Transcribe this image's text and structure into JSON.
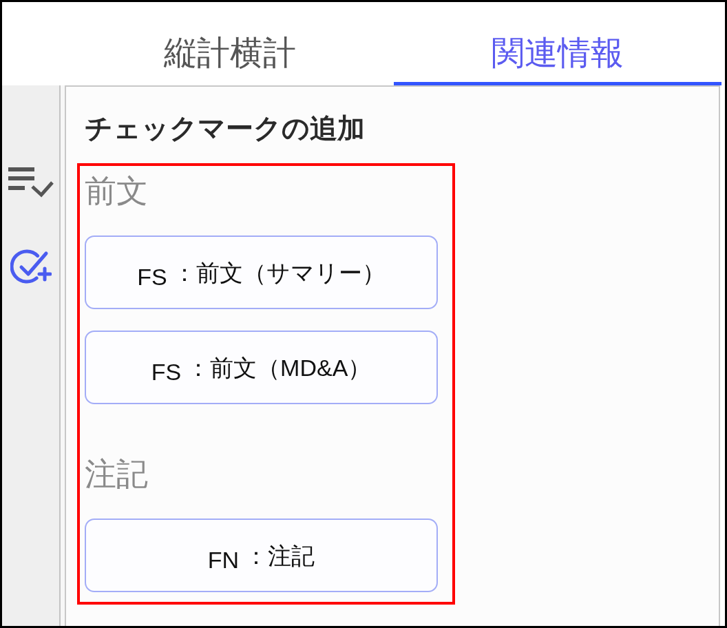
{
  "tabs": [
    {
      "label": "縦計横計",
      "selected": false
    },
    {
      "label": "関連情報",
      "selected": true
    }
  ],
  "sidebar": {
    "items": [
      {
        "kind": "list-check",
        "selected": false
      },
      {
        "kind": "check-add",
        "selected": true
      }
    ]
  },
  "panel": {
    "title": "チェックマークの追加",
    "sections": [
      {
        "heading": "前文",
        "buttons": [
          {
            "code": "FS",
            "label": "：前文（サマリー）"
          },
          {
            "code": "FS",
            "label": "：前文（MD&A）"
          }
        ]
      },
      {
        "heading": "注記",
        "buttons": [
          {
            "code": "FN",
            "label": "：注記"
          }
        ]
      }
    ]
  }
}
